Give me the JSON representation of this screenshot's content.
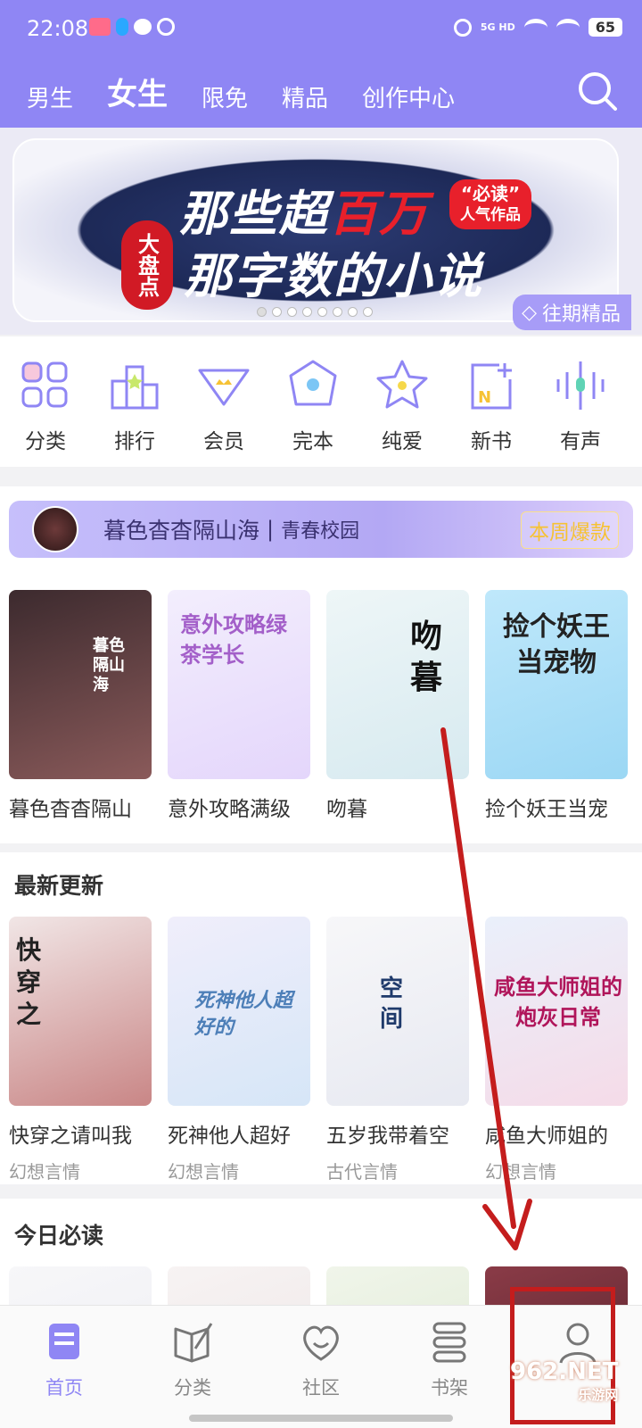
{
  "status_bar": {
    "time": "22:08",
    "network": "5G HD",
    "battery": "65"
  },
  "top_nav": {
    "tabs": [
      {
        "label": "男生",
        "active": false
      },
      {
        "label": "女生",
        "active": true
      },
      {
        "label": "限免",
        "active": false
      },
      {
        "label": "精品",
        "active": false
      },
      {
        "label": "创作中心",
        "active": false
      }
    ]
  },
  "banner": {
    "line1_prefix": "那些超",
    "line1_highlight": "百万",
    "line2": "那字数的小说",
    "seal": "大盘点",
    "tag_main": "“必读”",
    "tag_sub": "人气作品",
    "past_label": "往期精品",
    "page_count": 8,
    "current_page": 1
  },
  "categories": [
    {
      "label": "分类",
      "icon": "grid-icon"
    },
    {
      "label": "排行",
      "icon": "ranking-icon"
    },
    {
      "label": "会员",
      "icon": "vip-icon"
    },
    {
      "label": "完本",
      "icon": "finished-icon"
    },
    {
      "label": "纯爱",
      "icon": "star-icon"
    },
    {
      "label": "新书",
      "icon": "new-book-icon"
    },
    {
      "label": "有声",
      "icon": "audio-icon"
    }
  ],
  "hot": {
    "title": "暮色杳杳隔山海",
    "genre": "青春校园",
    "badge": "本周爆款",
    "books": [
      {
        "title": "暮色杳杳隔山",
        "cover_text": "暮色隔山海",
        "colors": [
          "#3c2a2e",
          "#8a5a5a"
        ]
      },
      {
        "title": "意外攻略满级",
        "cover_text": "意外攻略绿茶学长",
        "colors": [
          "#f3eefd",
          "#e4d6fb"
        ]
      },
      {
        "title": "吻暮",
        "cover_text": "吻暮",
        "colors": [
          "#eef6f7",
          "#d7eaf0"
        ]
      },
      {
        "title": "捡个妖王当宠",
        "cover_text": "捡个妖王当宠物",
        "colors": [
          "#bfe8fb",
          "#9bd7f4"
        ]
      }
    ]
  },
  "latest": {
    "header": "最新更新",
    "books": [
      {
        "title": "快穿之请叫我",
        "genre": "幻想言情",
        "cover_text": "快穿之",
        "colors": [
          "#f1e6e6",
          "#c98686"
        ]
      },
      {
        "title": "死神他人超好",
        "genre": "幻想言情",
        "cover_text": "死神他人超好的",
        "colors": [
          "#f0eefb",
          "#d6e6f7"
        ]
      },
      {
        "title": "五岁我带着空",
        "genre": "古代言情",
        "cover_text": "空间",
        "colors": [
          "#f7f7f9",
          "#e7e9f1"
        ]
      },
      {
        "title": "咸鱼大师姐的",
        "genre": "幻想言情",
        "cover_text": "咸鱼大师姐的炮灰日常",
        "colors": [
          "#eaf0fb",
          "#f5dbe8"
        ]
      }
    ]
  },
  "daily": {
    "header": "今日必读",
    "colors": [
      [
        "#f7f7f9",
        "#ececf2"
      ],
      [
        "#f7f3f3",
        "#ece4e4"
      ],
      [
        "#f0f5ea",
        "#dce8d0"
      ],
      [
        "#8a3b47",
        "#4b1d25"
      ]
    ]
  },
  "tab_bar": {
    "tabs": [
      {
        "label": "首页",
        "icon": "home-icon",
        "active": true
      },
      {
        "label": "分类",
        "icon": "category-icon",
        "active": false
      },
      {
        "label": "社区",
        "icon": "community-icon",
        "active": false
      },
      {
        "label": "书架",
        "icon": "bookshelf-icon",
        "active": false
      },
      {
        "label": "",
        "icon": "profile-icon",
        "active": false
      }
    ]
  },
  "watermark": {
    "main": "962.NET",
    "sub": "乐游网"
  },
  "accent_color": "#8f86f4",
  "annotation_color": "#c41d1d"
}
